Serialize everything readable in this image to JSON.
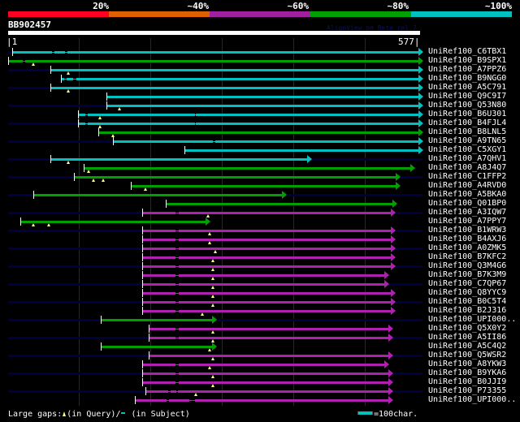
{
  "identity_scale": [
    {
      "label": "20%",
      "color": "#ff0022"
    },
    {
      "label": "~40%",
      "color": "#e06000"
    },
    {
      "label": "~60%",
      "color": "#a020a0"
    },
    {
      "label": "~80%",
      "color": "#00a000"
    },
    {
      "label": "~100%",
      "color": "#00c0c0"
    }
  ],
  "query": {
    "name": "BB902457",
    "start_label": "|1",
    "end_label": "577|",
    "length": 577
  },
  "version_text": "AlignView.pm Beta rel.7",
  "grid_every": 100,
  "hits": [
    {
      "label": "UniRef100_C6TBX1",
      "start": 7,
      "end": 575,
      "cls": 4,
      "qgaps": [],
      "sgaps": [
        [
          62,
          66
        ],
        [
          80,
          84
        ]
      ]
    },
    {
      "label": "UniRef100_B9SPX1",
      "start": 1,
      "end": 575,
      "cls": 3,
      "qgaps": [
        36
      ],
      "sgaps": [
        [
          22,
          25
        ]
      ]
    },
    {
      "label": "UniRef100_A7PPZ6",
      "start": 60,
      "end": 575,
      "cls": 4,
      "qgaps": [
        85
      ],
      "sgaps": []
    },
    {
      "label": "UniRef100_B9NGG0",
      "start": 75,
      "end": 575,
      "cls": 4,
      "qgaps": [],
      "sgaps": [
        [
          79,
          83
        ],
        [
          92,
          96
        ]
      ]
    },
    {
      "label": "UniRef100_A5C791",
      "start": 60,
      "end": 575,
      "cls": 4,
      "qgaps": [
        85
      ],
      "sgaps": []
    },
    {
      "label": "UniRef100_Q9C9I7",
      "start": 139,
      "end": 575,
      "cls": 4,
      "qgaps": [],
      "sgaps": []
    },
    {
      "label": "UniRef100_Q53N80",
      "start": 139,
      "end": 575,
      "cls": 4,
      "qgaps": [
        157
      ],
      "sgaps": []
    },
    {
      "label": "UniRef100_B6U301",
      "start": 99,
      "end": 575,
      "cls": 4,
      "qgaps": [
        129
      ],
      "sgaps": [
        [
          109,
          112
        ],
        [
          262,
          264
        ]
      ]
    },
    {
      "label": "UniRef100_B4FJL4",
      "start": 99,
      "end": 575,
      "cls": 4,
      "qgaps": [
        129
      ],
      "sgaps": [
        [
          109,
          112
        ],
        [
          262,
          264
        ]
      ]
    },
    {
      "label": "UniRef100_B8LNL5",
      "start": 127,
      "end": 575,
      "cls": 3,
      "qgaps": [
        147
      ],
      "sgaps": []
    },
    {
      "label": "UniRef100_A9TN65",
      "start": 148,
      "end": 575,
      "cls": 4,
      "qgaps": [],
      "sgaps": [
        [
          287,
          291
        ]
      ]
    },
    {
      "label": "UniRef100_C5XGY1",
      "start": 247,
      "end": 575,
      "cls": 4,
      "qgaps": [],
      "sgaps": []
    },
    {
      "label": "UniRef100_A7QHV1",
      "start": 60,
      "end": 419,
      "cls": 4,
      "qgaps": [
        85
      ],
      "sgaps": []
    },
    {
      "label": "UniRef100_A8J4Q7",
      "start": 107,
      "end": 563,
      "cls": 3,
      "qgaps": [
        113
      ],
      "sgaps": []
    },
    {
      "label": "UniRef100_C1FFP2",
      "start": 93,
      "end": 543,
      "cls": 3,
      "qgaps": [
        120,
        134
      ],
      "sgaps": []
    },
    {
      "label": "UniRef100_A4RVD0",
      "start": 172,
      "end": 543,
      "cls": 3,
      "qgaps": [
        193
      ],
      "sgaps": []
    },
    {
      "label": "UniRef100_A5BKA0",
      "start": 36,
      "end": 384,
      "cls": 3,
      "qgaps": [],
      "sgaps": []
    },
    {
      "label": "UniRef100_Q01BP0",
      "start": 221,
      "end": 538,
      "cls": 3,
      "qgaps": [],
      "sgaps": []
    },
    {
      "label": "UniRef100_A3IQW7",
      "start": 189,
      "end": 536,
      "cls": 2,
      "qgaps": [
        281
      ],
      "sgaps": [
        [
          235,
          240
        ]
      ]
    },
    {
      "label": "UniRef100_A7PPY7",
      "start": 18,
      "end": 277,
      "cls": 3,
      "qgaps": [
        36,
        58
      ],
      "sgaps": []
    },
    {
      "label": "UniRef100_B1WRW3",
      "start": 189,
      "end": 536,
      "cls": 2,
      "qgaps": [
        283
      ],
      "sgaps": [
        [
          235,
          240
        ]
      ]
    },
    {
      "label": "UniRef100_B4AXJ6",
      "start": 189,
      "end": 536,
      "cls": 2,
      "qgaps": [
        283
      ],
      "sgaps": [
        [
          235,
          240
        ]
      ]
    },
    {
      "label": "UniRef100_A0ZMK5",
      "start": 189,
      "end": 536,
      "cls": 2,
      "qgaps": [
        291
      ],
      "sgaps": [
        [
          235,
          240
        ]
      ]
    },
    {
      "label": "UniRef100_B7KFC2",
      "start": 189,
      "end": 536,
      "cls": 2,
      "qgaps": [
        287
      ],
      "sgaps": [
        [
          235,
          240
        ]
      ]
    },
    {
      "label": "UniRef100_Q3M4G6",
      "start": 189,
      "end": 536,
      "cls": 2,
      "qgaps": [
        287
      ],
      "sgaps": [
        [
          235,
          240
        ]
      ]
    },
    {
      "label": "UniRef100_B7K3M9",
      "start": 189,
      "end": 527,
      "cls": 2,
      "qgaps": [
        287
      ],
      "sgaps": [
        [
          235,
          240
        ]
      ]
    },
    {
      "label": "UniRef100_C7QP67",
      "start": 189,
      "end": 527,
      "cls": 2,
      "qgaps": [
        287
      ],
      "sgaps": [
        [
          235,
          240
        ]
      ]
    },
    {
      "label": "UniRef100_Q8YYC9",
      "start": 189,
      "end": 536,
      "cls": 2,
      "qgaps": [
        287
      ],
      "sgaps": [
        [
          235,
          240
        ]
      ]
    },
    {
      "label": "UniRef100_B0C5T4",
      "start": 189,
      "end": 536,
      "cls": 2,
      "qgaps": [
        287
      ],
      "sgaps": [
        [
          235,
          240
        ]
      ]
    },
    {
      "label": "UniRef100_B2J316",
      "start": 189,
      "end": 536,
      "cls": 2,
      "qgaps": [
        272
      ],
      "sgaps": [
        [
          235,
          240
        ]
      ]
    },
    {
      "label": "UniRef100_UPI000..",
      "start": 130,
      "end": 286,
      "cls": 3,
      "qgaps": [],
      "sgaps": []
    },
    {
      "label": "UniRef100_Q5X0Y2",
      "start": 198,
      "end": 533,
      "cls": 2,
      "qgaps": [
        287
      ],
      "sgaps": [
        [
          235,
          240
        ]
      ]
    },
    {
      "label": "UniRef100_A5II86",
      "start": 198,
      "end": 533,
      "cls": 2,
      "qgaps": [
        287
      ],
      "sgaps": [
        [
          235,
          240
        ]
      ]
    },
    {
      "label": "UniRef100_A5C4Q2",
      "start": 130,
      "end": 286,
      "cls": 3,
      "qgaps": [
        283
      ],
      "sgaps": []
    },
    {
      "label": "UniRef100_Q5WSR2",
      "start": 198,
      "end": 533,
      "cls": 2,
      "qgaps": [
        287
      ],
      "sgaps": []
    },
    {
      "label": "UniRef100_A8YKW3",
      "start": 189,
      "end": 527,
      "cls": 2,
      "qgaps": [
        283
      ],
      "sgaps": [
        [
          235,
          240
        ]
      ]
    },
    {
      "label": "UniRef100_B9YKA6",
      "start": 189,
      "end": 533,
      "cls": 2,
      "qgaps": [
        287
      ],
      "sgaps": [
        [
          235,
          240
        ]
      ]
    },
    {
      "label": "UniRef100_B0JJI9",
      "start": 189,
      "end": 533,
      "cls": 2,
      "qgaps": [
        287
      ],
      "sgaps": [
        [
          235,
          240
        ]
      ]
    },
    {
      "label": "UniRef100_P73355",
      "start": 193,
      "end": 533,
      "cls": 2,
      "qgaps": [
        263
      ],
      "sgaps": [
        [
          225,
          228
        ],
        [
          236,
          238
        ]
      ]
    },
    {
      "label": "UniRef100_UPI000..",
      "start": 178,
      "end": 533,
      "cls": 2,
      "qgaps": [],
      "sgaps": [
        [
          222,
          226
        ],
        [
          254,
          262
        ]
      ]
    }
  ],
  "legend": {
    "large_gaps": "Large gaps:",
    "in_query": "(in Query)/",
    "in_subject": " (in Subject)",
    "scale": "=100char."
  }
}
